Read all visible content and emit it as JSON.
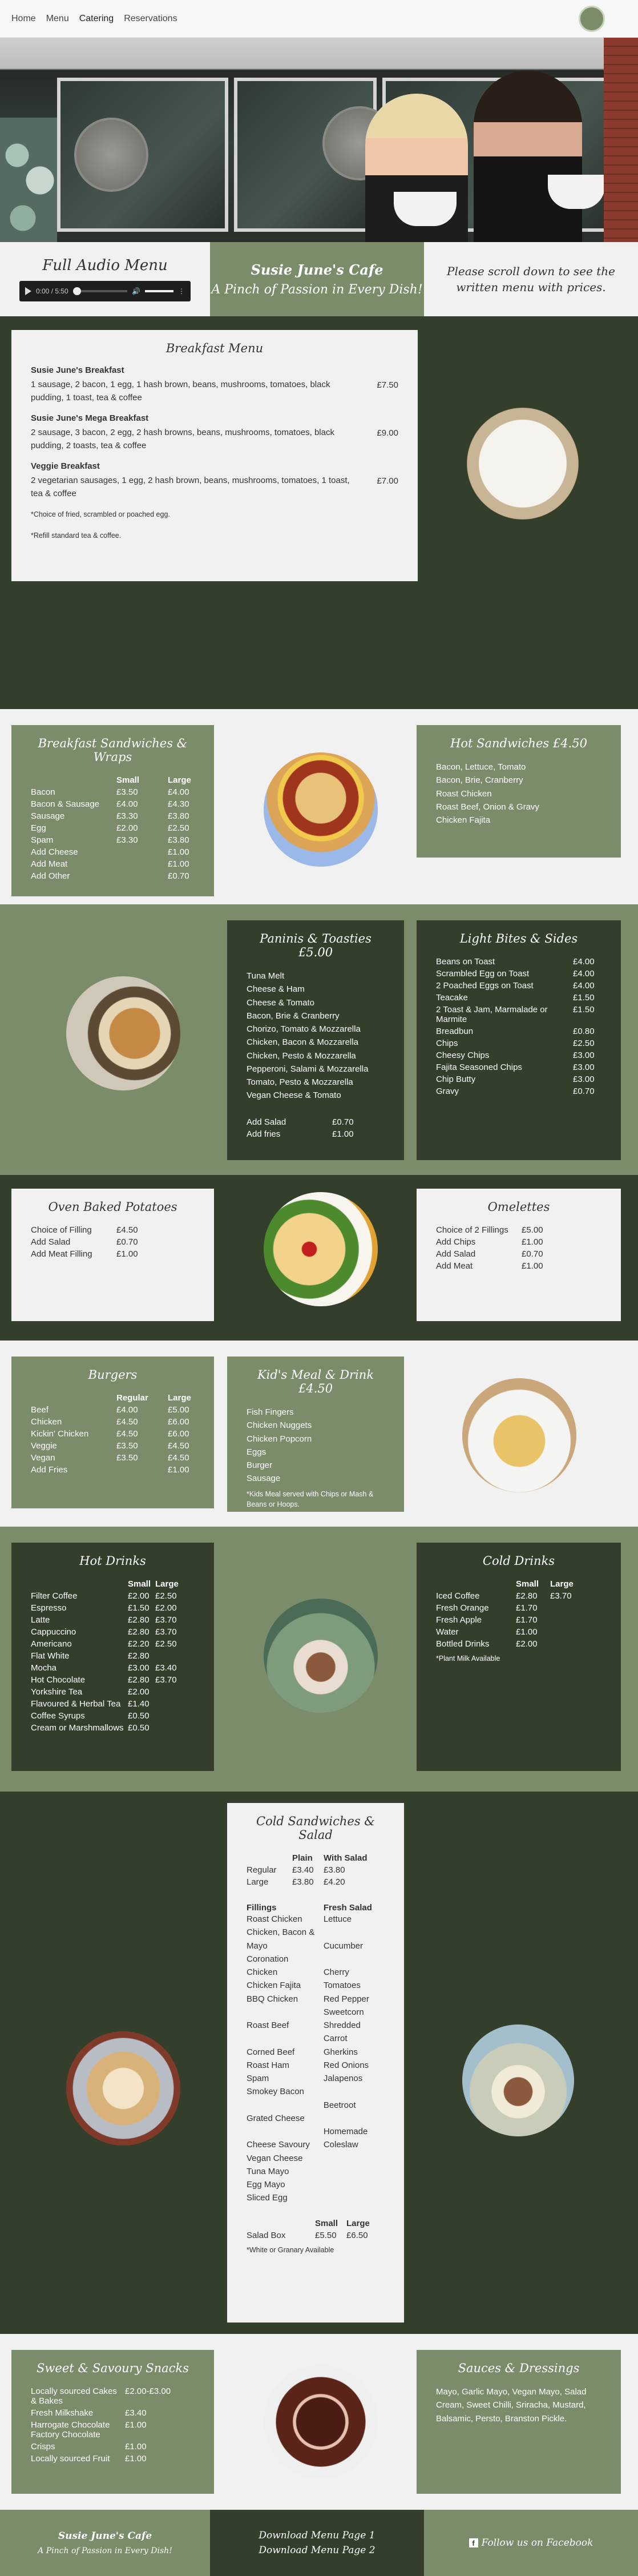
{
  "nav": {
    "items": [
      {
        "label": "Home"
      },
      {
        "label": "Menu"
      },
      {
        "label": "Catering"
      },
      {
        "label": "Reservations"
      }
    ]
  },
  "audio": {
    "title": "Full Audio Menu",
    "time": "0:00 / 5:50"
  },
  "cafe": {
    "name": "Susie June's Cafe",
    "tagline": "A Pinch of Passion in Every Dish!"
  },
  "scroll_note": "Please scroll down to see the written menu with prices.",
  "breakfast": {
    "title": "Breakfast Menu",
    "items": [
      {
        "name": "Susie June's Breakfast",
        "desc": "1 sausage, 2 bacon, 1 egg, 1 hash brown, beans, mushrooms, tomatoes, black pudding, 1 toast, tea & coffee",
        "price": "£7.50"
      },
      {
        "name": "Susie June's Mega Breakfast",
        "desc": "2 sausage, 3 bacon, 2 egg, 2 hash browns, beans, mushrooms, tomatoes, black pudding, 2 toasts, tea & coffee",
        "price": "£9.00"
      },
      {
        "name": "Veggie Breakfast",
        "desc": "2 vegetarian sausages, 1 egg, 2 hash brown, beans, mushrooms, tomatoes, 1 toast, tea & coffee",
        "price": "£7.00"
      }
    ],
    "note1": "*Choice of fried, scrambled or poached egg.",
    "note2": "*Refill standard tea & coffee."
  },
  "bsandwiches": {
    "title": "Breakfast Sandwiches & Wraps",
    "col1": "Small",
    "col2": "Large",
    "rows": [
      {
        "name": "Bacon",
        "small": "£3.50",
        "large": "£4.00"
      },
      {
        "name": "Bacon & Sausage",
        "small": "£4.00",
        "large": "£4.30"
      },
      {
        "name": "Sausage",
        "small": "£3.30",
        "large": "£3.80"
      },
      {
        "name": "Egg",
        "small": "£2.00",
        "large": "£2.50"
      },
      {
        "name": "Spam",
        "small": "£3.30",
        "large": "£3.80"
      },
      {
        "name": "Add Cheese",
        "small": "",
        "large": "£1.00"
      },
      {
        "name": "Add Meat",
        "small": "",
        "large": "£1.00"
      },
      {
        "name": "Add Other",
        "small": "",
        "large": "£0.70"
      }
    ]
  },
  "hot_sandwiches": {
    "title": "Hot Sandwiches £4.50",
    "items": [
      "Bacon, Lettuce, Tomato",
      "Bacon, Brie, Cranberry",
      "Roast Chicken",
      "Roast Beef, Onion & Gravy",
      "Chicken Fajita"
    ]
  },
  "paninis": {
    "title": "Paninis & Toasties £5.00",
    "items": [
      "Tuna Melt",
      "Cheese & Ham",
      "Cheese & Tomato",
      "Bacon, Brie & Cranberry",
      "Chorizo, Tomato & Mozzarella",
      "Chicken, Bacon & Mozzarella",
      "Chicken, Pesto & Mozzarella",
      "Pepperoni, Salami & Mozzarella",
      "Tomato, Pesto & Mozzarella",
      "Vegan Cheese & Tomato"
    ],
    "extras": [
      {
        "name": "Add Salad",
        "price": "£0.70"
      },
      {
        "name": "Add fries",
        "price": "£1.00"
      }
    ]
  },
  "light_bites": {
    "title": "Light Bites & Sides",
    "items": [
      {
        "name": "Beans on Toast",
        "price": "£4.00"
      },
      {
        "name": "Scrambled Egg on Toast",
        "price": "£4.00"
      },
      {
        "name": "2 Poached Eggs on Toast",
        "price": "£4.00"
      },
      {
        "name": "Teacake",
        "price": "£1.50"
      },
      {
        "name": "2 Toast & Jam, Marmalade or Marmite",
        "price": "£1.50"
      },
      {
        "name": "Breadbun",
        "price": "£0.80"
      },
      {
        "name": "Chips",
        "price": "£2.50"
      },
      {
        "name": "Cheesy Chips",
        "price": "£3.00"
      },
      {
        "name": "Fajita Seasoned Chips",
        "price": "£3.00"
      },
      {
        "name": "Chip Butty",
        "price": "£3.00"
      },
      {
        "name": "Gravy",
        "price": "£0.70"
      }
    ]
  },
  "potatoes": {
    "title": "Oven Baked Potatoes",
    "items": [
      {
        "name": "Choice of Filling",
        "price": "£4.50"
      },
      {
        "name": "Add Salad",
        "price": "£0.70"
      },
      {
        "name": "Add Meat Filling",
        "price": "£1.00"
      }
    ]
  },
  "omelettes": {
    "title": "Omelettes",
    "items": [
      {
        "name": "Choice of 2 Fillings",
        "price": "£5.00"
      },
      {
        "name": "Add Chips",
        "price": "£1.00"
      },
      {
        "name": "Add Salad",
        "price": "£0.70"
      },
      {
        "name": "Add Meat",
        "price": "£1.00"
      }
    ]
  },
  "burgers": {
    "title": "Burgers",
    "col1": "Regular",
    "col2": "Large",
    "rows": [
      {
        "name": "Beef",
        "a": "£4.00",
        "b": "£5.00"
      },
      {
        "name": "Chicken",
        "a": "£4.50",
        "b": "£6.00"
      },
      {
        "name": "Kickin' Chicken",
        "a": "£4.50",
        "b": "£6.00"
      },
      {
        "name": "Veggie",
        "a": "£3.50",
        "b": "£4.50"
      },
      {
        "name": "Vegan",
        "a": "£3.50",
        "b": "£4.50"
      },
      {
        "name": "Add Fries",
        "a": "",
        "b": "£1.00"
      }
    ]
  },
  "kids": {
    "title": "Kid's Meal & Drink £4.50",
    "items": [
      "Fish Fingers",
      "Chicken Nuggets",
      "Chicken Popcorn",
      "Eggs",
      "Burger",
      "Sausage"
    ],
    "note": "*Kids Meal served with Chips or Mash & Beans or Hoops."
  },
  "hot_drinks": {
    "title": "Hot Drinks",
    "col1": "Small",
    "col2": "Large",
    "rows": [
      {
        "name": "Filter Coffee",
        "a": "£2.00",
        "b": "£2.50"
      },
      {
        "name": "Espresso",
        "a": "£1.50",
        "b": "£2.00"
      },
      {
        "name": "Latte",
        "a": "£2.80",
        "b": "£3.70"
      },
      {
        "name": "Cappuccino",
        "a": "£2.80",
        "b": "£3.70"
      },
      {
        "name": "Americano",
        "a": "£2.20",
        "b": "£2.50"
      },
      {
        "name": "Flat White",
        "a": "£2.80",
        "b": ""
      },
      {
        "name": "Mocha",
        "a": "£3.00",
        "b": "£3.40"
      },
      {
        "name": "Hot Chocolate",
        "a": "£2.80",
        "b": "£3.70"
      },
      {
        "name": "Yorkshire Tea",
        "a": "£2.00",
        "b": ""
      },
      {
        "name": "Flavoured & Herbal Tea",
        "a": "£1.40",
        "b": ""
      },
      {
        "name": "Coffee Syrups",
        "a": "£0.50",
        "b": ""
      },
      {
        "name": "Cream or Marshmallows",
        "a": "£0.50",
        "b": ""
      }
    ]
  },
  "cold_drinks": {
    "title": "Cold Drinks",
    "col1": "Small",
    "col2": "Large",
    "rows": [
      {
        "name": "Iced Coffee",
        "a": "£2.80",
        "b": "£3.70"
      },
      {
        "name": "Fresh Orange",
        "a": "£1.70",
        "b": ""
      },
      {
        "name": "Fresh Apple",
        "a": "£1.70",
        "b": ""
      },
      {
        "name": "Water",
        "a": "£1.00",
        "b": ""
      },
      {
        "name": "Bottled Drinks",
        "a": "£2.00",
        "b": ""
      }
    ],
    "note": "*Plant Milk Available"
  },
  "cold_sandwiches": {
    "title": "Cold Sandwiches & Salad",
    "col1": "Plain",
    "col2": "With Salad",
    "sizes": [
      {
        "name": "Regular",
        "a": "£3.40",
        "b": "£3.80"
      },
      {
        "name": "Large",
        "a": "£3.80",
        "b": "£4.20"
      }
    ],
    "fillings_title": "Fillings",
    "fillings": [
      "Roast Chicken",
      "Chicken, Bacon & Mayo",
      "Coronation Chicken",
      "Chicken Fajita",
      "BBQ Chicken",
      "",
      "Roast Beef",
      "",
      "Corned Beef",
      "Roast Ham",
      "Spam",
      "Smokey Bacon",
      "",
      "Grated Cheese",
      "",
      "Cheese Savoury",
      "Vegan Cheese",
      "Tuna Mayo",
      "Egg Mayo",
      "Sliced Egg"
    ],
    "salad_title": "Fresh Salad",
    "salad": [
      "Lettuce",
      "",
      "Cucumber",
      "",
      "Cherry Tomatoes",
      "Red Pepper",
      "Sweetcorn",
      "Shredded Carrot",
      "Gherkins",
      "Red Onions",
      "Jalapenos",
      "",
      "Beetroot",
      "",
      "Homemade Coleslaw"
    ],
    "box_col1": "Small",
    "box_col2": "Large",
    "box_name": "Salad Box",
    "box_a": "£5.50",
    "box_b": "£6.50",
    "note": "*White or Granary Available"
  },
  "snacks": {
    "title": "Sweet & Savoury Snacks",
    "items": [
      {
        "name": "Locally sourced Cakes & Bakes",
        "price": "£2.00-£3.00"
      },
      {
        "name": "Fresh Milkshake",
        "price": "£3.40"
      },
      {
        "name": "Harrogate Chocolate Factory Chocolate",
        "price": "£1.00"
      },
      {
        "name": "Crisps",
        "price": "£1.00"
      },
      {
        "name": "Locally sourced Fruit",
        "price": "£1.00"
      }
    ]
  },
  "sauces": {
    "title": "Sauces & Dressings",
    "text": "Mayo, Garlic Mayo, Vegan Mayo, Salad Cream, Sweet Chilli, Sriracha, Mustard, Balsamic, Persto, Branston Pickle."
  },
  "footer": {
    "name": "Susie June's Cafe",
    "tagline": "A Pinch of Passion in Every Dish!",
    "download1": "Download Menu Page 1",
    "download2": "Download Menu Page 2",
    "facebook": "Follow us on Facebook"
  }
}
